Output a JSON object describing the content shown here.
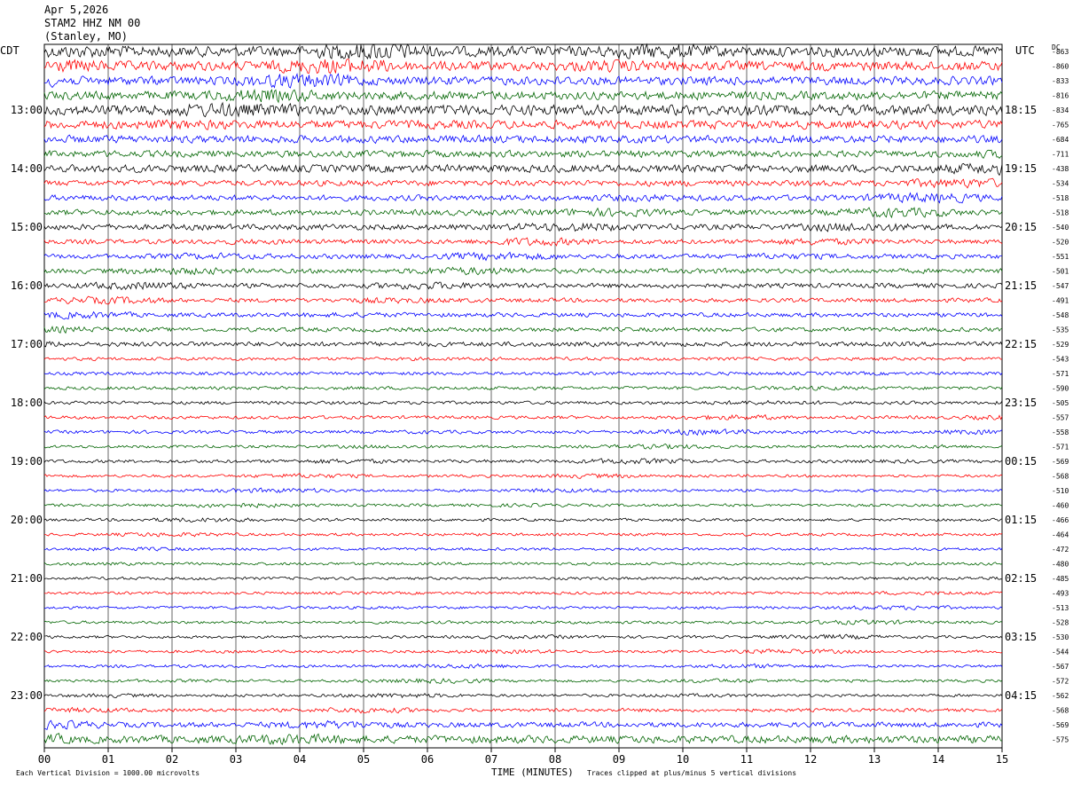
{
  "header": {
    "date": "Apr 5,2026",
    "station": "STAM2 HHZ NM 00",
    "location": "(Stanley, MO)"
  },
  "left_tz": "CDT",
  "right_tz": "UTC",
  "dc_label": "DC",
  "footer": {
    "scale_note": "Each Vertical Division = 1000.00 microvolts",
    "xlabel": "TIME (MINUTES)",
    "clip_note": "Traces clipped at plus/minus 5 vertical divisions"
  },
  "chart_data": {
    "type": "line",
    "title": "STAM2 HHZ NM 00 (Stanley, MO) Apr 5,2026",
    "xlabel": "TIME (MINUTES)",
    "xlim": [
      0,
      15
    ],
    "x_ticks": [
      "00",
      "01",
      "02",
      "03",
      "04",
      "05",
      "06",
      "07",
      "08",
      "09",
      "10",
      "11",
      "12",
      "13",
      "14",
      "15"
    ],
    "trace_colors": [
      "#000000",
      "#ff0000",
      "#0000ff",
      "#006400"
    ],
    "left_hour_labels": [
      "13:00",
      "14:00",
      "15:00",
      "16:00",
      "17:00",
      "18:00",
      "19:00",
      "20:00",
      "21:00",
      "22:00",
      "23:00"
    ],
    "right_hour_labels": [
      "18:15",
      "19:15",
      "20:15",
      "21:15",
      "22:15",
      "23:15",
      "00:15",
      "01:15",
      "02:15",
      "03:15",
      "04:15"
    ],
    "dc_offsets": [
      -863,
      -860,
      -833,
      -816,
      -834,
      -765,
      -684,
      -711,
      -438,
      -534,
      -518,
      -518,
      -540,
      -520,
      -551,
      -501,
      -547,
      -491,
      -548,
      -535,
      -529,
      -543,
      -571,
      -590,
      -505,
      -557,
      -558,
      -571,
      -569,
      -568,
      -510,
      -460,
      -466,
      -464,
      -472,
      -480,
      -485,
      -493,
      -513,
      -528,
      -530,
      -544,
      -567,
      -572,
      -562,
      -568,
      -569,
      -575
    ],
    "trace_activity": [
      2.2,
      2.0,
      1.8,
      1.8,
      2.2,
      1.8,
      1.6,
      1.4,
      1.6,
      1.2,
      1.2,
      1.2,
      1.2,
      1.0,
      1.0,
      1.0,
      1.0,
      0.9,
      0.9,
      0.9,
      1.0,
      0.7,
      0.7,
      0.7,
      0.7,
      0.7,
      0.7,
      0.6,
      0.7,
      0.6,
      0.6,
      0.6,
      0.6,
      0.6,
      0.6,
      0.6,
      0.6,
      0.6,
      0.6,
      0.6,
      0.6,
      0.6,
      0.6,
      0.6,
      0.6,
      0.7,
      1.1,
      1.6
    ],
    "units": "microvolts",
    "vertical_division_microvolts": 1000.0
  }
}
